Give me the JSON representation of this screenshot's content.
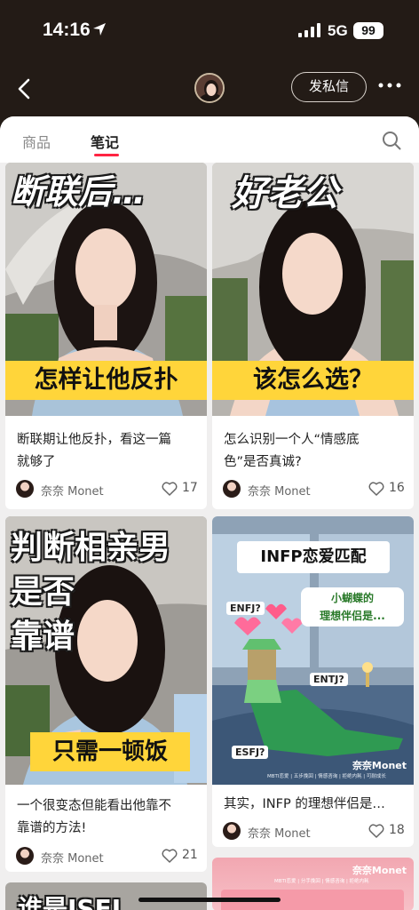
{
  "status_bar": {
    "time": "14:16",
    "network": "5G",
    "battery": "99"
  },
  "header": {
    "message_button": "发私信"
  },
  "tabs": [
    {
      "label": "商品"
    },
    {
      "label": "笔记"
    }
  ],
  "colors": {
    "accent": "#ff2442",
    "yellow": "#ffd53a",
    "header_bg": "#231b16"
  },
  "cards": [
    {
      "overlay_top": "断联后…",
      "overlay_bottom": "怎样让他反扑",
      "title_line1": "断联期让他反扑，看这一篇",
      "title_line2": "就够了",
      "author": "奈奈 Monet",
      "likes": "17"
    },
    {
      "overlay_top": "好老公",
      "overlay_bottom": "该怎么选？",
      "title_line1": "怎么识别一个人“情感底",
      "title_line2": "色”是否真诚?",
      "author": "奈奈 Monet",
      "likes": "16"
    },
    {
      "overlay_line1": "判断相亲男",
      "overlay_line2": "是否",
      "overlay_line3": "靠谱",
      "overlay_bottom": "只需一顿饭",
      "title_line1": "一个很变态但能看出他靠不",
      "title_line2": "靠谱的方法!",
      "author": "奈奈 Monet",
      "likes": "21"
    },
    {
      "overlay_banner": "INFP恋爱匹配",
      "overlay_bubble_line1": "小蝴蝶的",
      "overlay_bubble_line2": "理想伴侣是...",
      "tag1": "ENFJ?",
      "tag2": "ENTJ?",
      "tag3": "ESFJ?",
      "watermark": "奈奈Monet",
      "watermark_sub": "MBTI恋爱 | 五步挽回 | 情感咨询 | 拒绝内耗 | 可耐成长",
      "title_line1": "其实，INFP 的理想伴侣是…",
      "author": "奈奈 Monet",
      "likes": "18"
    },
    {
      "overlay_partial": "谁是ISFJ",
      "author": ""
    },
    {
      "watermark": "奈奈Monet",
      "watermark_sub": "MBTI恋爱 | 分手挽回 | 情感咨询 | 拒绝内耗"
    }
  ]
}
